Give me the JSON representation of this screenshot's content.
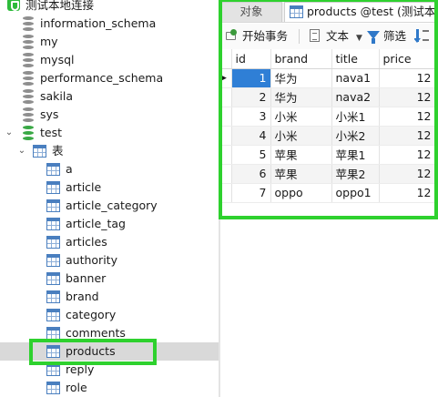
{
  "navigator": {
    "connection": "测试本地连接",
    "databases": [
      "information_schema",
      "my",
      "mysql",
      "performance_schema",
      "sakila",
      "sys"
    ],
    "open_database": "test",
    "tables_folder": "表",
    "tables": [
      "a",
      "article",
      "article_category",
      "article_tag",
      "articles",
      "authority",
      "banner",
      "brand",
      "category",
      "comments",
      "products",
      "reply",
      "role"
    ],
    "selected_table": "products"
  },
  "tabs": {
    "objects": "对象",
    "products": "products @test (测试本地"
  },
  "toolbar": {
    "transaction": "开始事务",
    "text": "文本",
    "filter": "筛选"
  },
  "grid": {
    "columns": [
      "id",
      "brand",
      "title",
      "price"
    ],
    "rows": [
      {
        "id": "1",
        "brand": "华为",
        "title": "nava1",
        "price": "12"
      },
      {
        "id": "2",
        "brand": "华为",
        "title": "nava2",
        "price": "12"
      },
      {
        "id": "3",
        "brand": "小米",
        "title": "小米1",
        "price": "12"
      },
      {
        "id": "4",
        "brand": "小米",
        "title": "小米2",
        "price": "12"
      },
      {
        "id": "5",
        "brand": "苹果",
        "title": "苹果1",
        "price": "12"
      },
      {
        "id": "6",
        "brand": "苹果",
        "title": "苹果2",
        "price": "12"
      },
      {
        "id": "7",
        "brand": "oppo",
        "title": "oppo1",
        "price": "12"
      }
    ]
  },
  "colors": {
    "highlight": "#2ed12e",
    "selected_cell": "#2f7fd6",
    "selected_row_bg": "#d9d9d9"
  }
}
